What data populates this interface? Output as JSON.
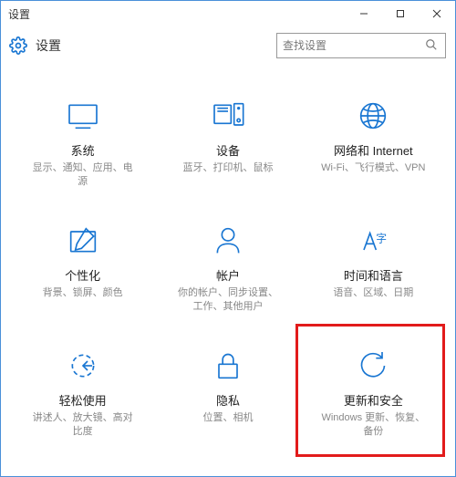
{
  "window": {
    "title": "设置"
  },
  "header": {
    "title": "设置"
  },
  "search": {
    "placeholder": "查找设置"
  },
  "tiles": [
    {
      "label": "系统",
      "desc": "显示、通知、应用、电源"
    },
    {
      "label": "设备",
      "desc": "蓝牙、打印机、鼠标"
    },
    {
      "label": "网络和 Internet",
      "desc": "Wi-Fi、飞行模式、VPN"
    },
    {
      "label": "个性化",
      "desc": "背景、锁屏、颜色"
    },
    {
      "label": "帐户",
      "desc": "你的帐户、同步设置、工作、其他用户"
    },
    {
      "label": "时间和语言",
      "desc": "语音、区域、日期"
    },
    {
      "label": "轻松使用",
      "desc": "讲述人、放大镜、高对比度"
    },
    {
      "label": "隐私",
      "desc": "位置、相机"
    },
    {
      "label": "更新和安全",
      "desc": "Windows 更新、恢复、备份"
    }
  ]
}
